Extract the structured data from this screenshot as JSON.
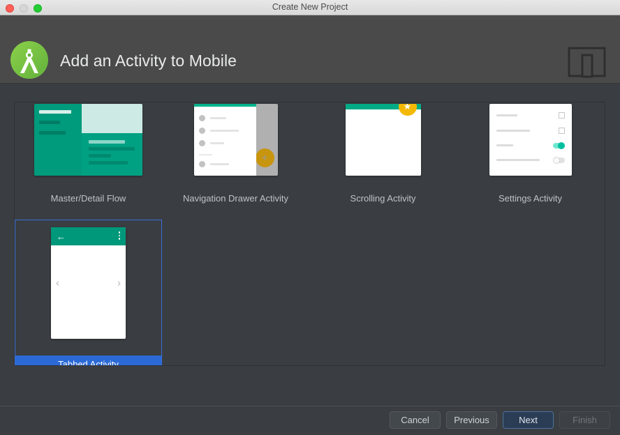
{
  "window": {
    "title": "Create New Project",
    "traffic_lights": [
      "close",
      "minimize",
      "zoom"
    ]
  },
  "header": {
    "title": "Add an Activity to Mobile",
    "logo_icon": "android-studio-logo-icon",
    "device_icon": "mobile-device-icon",
    "background": "#4a4a4a"
  },
  "gallery": {
    "templates": [
      {
        "label": "Master/Detail Flow",
        "thumb": "master-detail-flow-thumbnail",
        "selected": false
      },
      {
        "label": "Navigation Drawer Activity",
        "thumb": "navigation-drawer-activity-thumbnail",
        "selected": false
      },
      {
        "label": "Scrolling Activity",
        "thumb": "scrolling-activity-thumbnail",
        "selected": false
      },
      {
        "label": "Settings Activity",
        "thumb": "settings-activity-thumbnail",
        "selected": false
      },
      {
        "label": "Tabbed Activity",
        "thumb": "tabbed-activity-thumbnail",
        "selected": true
      }
    ],
    "selection_color": "#2b6ad6"
  },
  "footer": {
    "buttons": [
      {
        "label": "Cancel",
        "state": "normal"
      },
      {
        "label": "Previous",
        "state": "normal"
      },
      {
        "label": "Next",
        "state": "default"
      },
      {
        "label": "Finish",
        "state": "disabled"
      }
    ]
  },
  "colors": {
    "accent_teal": "#00987a",
    "accent_amber": "#f5b800",
    "accent_blue": "#2b6ad6",
    "body_bg": "#3a3e42"
  }
}
